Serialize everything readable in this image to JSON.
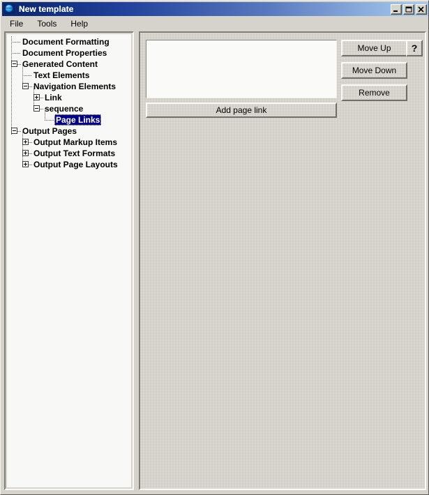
{
  "window": {
    "title": "New template",
    "icon": "globe-icon",
    "controls": [
      {
        "name": "minimize",
        "glyph": "_"
      },
      {
        "name": "maximize",
        "glyph": "□"
      },
      {
        "name": "close",
        "glyph": "✕"
      }
    ]
  },
  "menubar": {
    "items": [
      {
        "label": "File"
      },
      {
        "label": "Tools"
      },
      {
        "label": "Help"
      }
    ]
  },
  "tree": {
    "selected": "Page Links",
    "nodes": [
      {
        "label": "Document Formatting",
        "depth": 0,
        "expander": "none"
      },
      {
        "label": "Document Properties",
        "depth": 0,
        "expander": "none"
      },
      {
        "label": "Generated Content",
        "depth": 0,
        "expander": "minus"
      },
      {
        "label": "Text Elements",
        "depth": 1,
        "expander": "none"
      },
      {
        "label": "Navigation Elements",
        "depth": 1,
        "expander": "minus"
      },
      {
        "label": "Link",
        "depth": 2,
        "expander": "plus"
      },
      {
        "label": "sequence",
        "depth": 2,
        "expander": "minus"
      },
      {
        "label": "Page Links",
        "depth": 3,
        "expander": "none",
        "selected": true
      },
      {
        "label": "Output Pages",
        "depth": 0,
        "expander": "minus"
      },
      {
        "label": "Output Markup Items",
        "depth": 1,
        "expander": "plus"
      },
      {
        "label": "Output Text Formats",
        "depth": 1,
        "expander": "plus"
      },
      {
        "label": "Output Page Layouts",
        "depth": 1,
        "expander": "plus"
      }
    ]
  },
  "panel": {
    "list": {
      "items": [],
      "placeholder": ""
    },
    "add_button": "Add page link",
    "move_up_button": "Move Up",
    "move_down_button": "Move Down",
    "remove_button": "Remove",
    "help_button": "?"
  },
  "colors": {
    "title_gradient_start": "#0a246a",
    "title_gradient_end": "#a6caf0",
    "selection": "#000080",
    "face": "#d6d3cc",
    "field": "#fafaf8"
  }
}
